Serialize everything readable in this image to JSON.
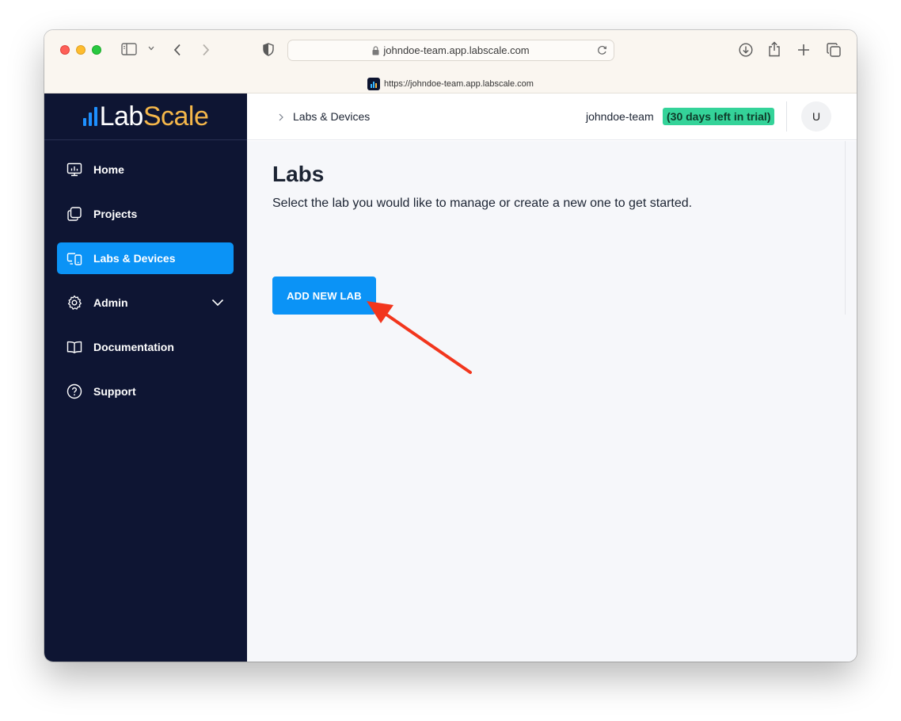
{
  "browser": {
    "url_display": "johndoe-team.app.labscale.com",
    "tab_url": "https://johndoe-team.app.labscale.com"
  },
  "logo": {
    "part1": "Lab",
    "part2": "Scale",
    "colors": {
      "lab": "#ffffff",
      "scale": "#f5b74a"
    }
  },
  "sidebar": {
    "items": [
      {
        "label": "Home",
        "icon": "monitor-chart-icon",
        "active": false
      },
      {
        "label": "Projects",
        "icon": "copy-squares-icon",
        "active": false
      },
      {
        "label": "Labs & Devices",
        "icon": "devices-icon",
        "active": true
      },
      {
        "label": "Admin",
        "icon": "gear-icon",
        "active": false,
        "expandable": true
      },
      {
        "label": "Documentation",
        "icon": "book-icon",
        "active": false
      },
      {
        "label": "Support",
        "icon": "help-circle-icon",
        "active": false
      }
    ]
  },
  "header": {
    "breadcrumb": "Labs & Devices",
    "team": "johndoe-team",
    "trial_badge": "(30 days left in trial)",
    "avatar_initial": "U"
  },
  "main": {
    "title": "Labs",
    "subtitle": "Select the lab you would like to manage or create a new one to get started.",
    "add_button": "ADD NEW LAB"
  },
  "colors": {
    "accent": "#0b93f6",
    "sidebar_bg": "#0e1533",
    "trial_green": "#34d399",
    "annotation_arrow": "#f2361d"
  }
}
